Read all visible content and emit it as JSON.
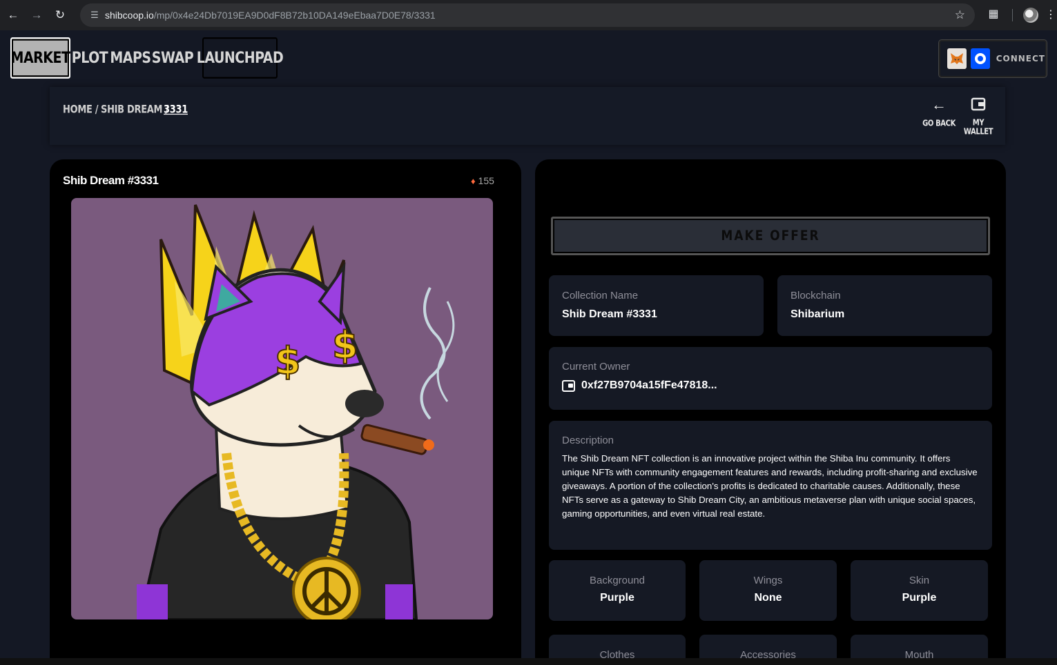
{
  "browser": {
    "url_host": "shibcoop.io",
    "url_path": "/mp/0x4e24Db7019EA9D0dF8B72b10DA149eEbaa7D0E78/3331"
  },
  "nav": {
    "market": "MARKET",
    "plot": "PLOT",
    "maps": "MAPS",
    "swap": "SWAP",
    "launchpad": "LAUNCHPAD",
    "connect": "CONNECT"
  },
  "breadcrumb": {
    "home": "HOME /",
    "collection": "SHIB DREAM /",
    "current": "3331"
  },
  "actions": {
    "go_back": "GO BACK",
    "my_wallet": "MY WALLET"
  },
  "nft": {
    "title": "Shib Dream #3331",
    "rank": "155"
  },
  "details": {
    "make_offer": "MAKE OFFER",
    "collection_label": "Collection Name",
    "collection_value": "Shib Dream #3331",
    "blockchain_label": "Blockchain",
    "blockchain_value": "Shibarium",
    "owner_label": "Current Owner",
    "owner_value": "0xf27B9704a15fFe47818...",
    "description_label": "Description",
    "description_text": "The Shib Dream NFT collection is an innovative project within the Shiba Inu community. It offers unique NFTs with community engagement features and rewards, including profit-sharing and exclusive giveaways. A portion of the collection's profits is dedicated to charitable causes. Additionally, these NFTs serve as a gateway to Shib Dream City, an ambitious metaverse plan with unique social spaces, gaming opportunities, and even virtual real estate."
  },
  "traits": [
    {
      "label": "Background",
      "value": "Purple"
    },
    {
      "label": "Wings",
      "value": "None"
    },
    {
      "label": "Skin",
      "value": "Purple"
    },
    {
      "label": "Clothes",
      "value": ""
    },
    {
      "label": "Accessories",
      "value": ""
    },
    {
      "label": "Mouth",
      "value": ""
    }
  ],
  "colors": {
    "page_bg": "#141824",
    "card_bg": "#000000",
    "info_bg": "#151924",
    "nft_bg": "#7a5a7e"
  }
}
